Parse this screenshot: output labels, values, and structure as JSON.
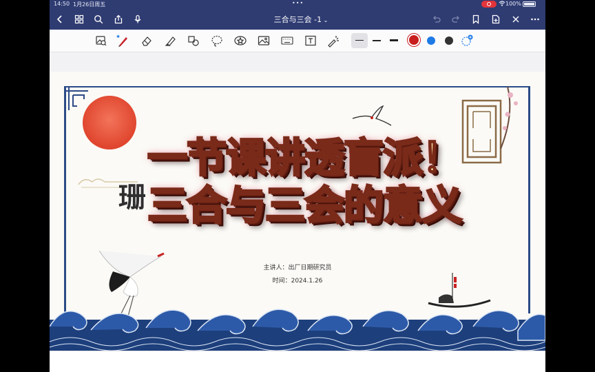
{
  "status_bar": {
    "time": "14:50",
    "date": "1月26日周五",
    "battery": "100%"
  },
  "nav": {
    "title": "三合与三会 -1"
  },
  "toolbar": {
    "tools": [
      "lasso-image-icon",
      "pen-icon",
      "eraser-icon",
      "highlighter-icon",
      "shapes-icon",
      "lasso-icon",
      "sticker-icon",
      "image-icon",
      "keyboard-icon",
      "text-box-icon",
      "laser-pointer-icon"
    ],
    "colors": [
      "#c81e1e",
      "#1e7be6",
      "#333333"
    ]
  },
  "slide": {
    "title_line1": "一节课讲透盲派！",
    "title_line2": "三合与三会的意义",
    "presenter": "主讲人：出厂日期研究员",
    "date_line": "时间：2024.1.26"
  }
}
